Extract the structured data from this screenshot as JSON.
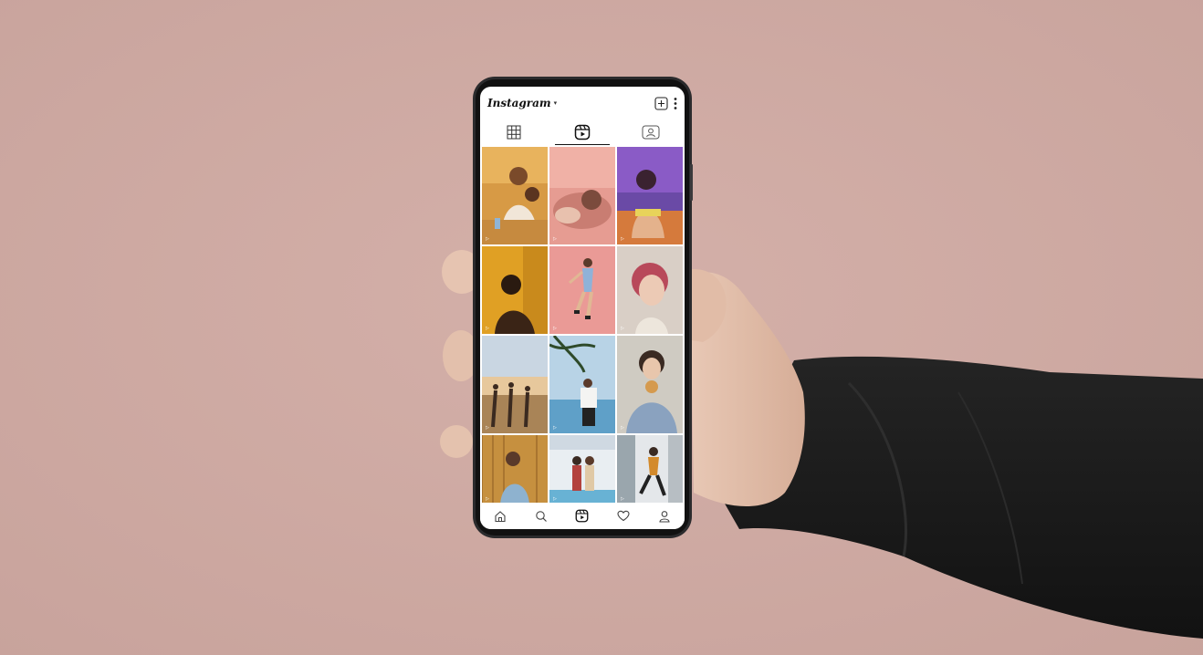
{
  "app": {
    "title": "Instagram",
    "account_dropdown_icon": "chevron-down-icon",
    "header_icons": [
      "add-post-icon",
      "more-options-icon"
    ]
  },
  "profile_tabs": [
    {
      "name": "posts-grid",
      "icon": "grid-icon",
      "active": false
    },
    {
      "name": "reels",
      "icon": "reels-icon",
      "active": true
    },
    {
      "name": "tagged",
      "icon": "tagged-user-icon",
      "active": false
    }
  ],
  "reels_grid": {
    "columns": 3,
    "tiles": [
      {
        "subject": "two women at a cafe table",
        "play_icon": "play-icon"
      },
      {
        "subject": "woman lying down, pink light",
        "play_icon": "play-icon"
      },
      {
        "subject": "woman in neon purple light",
        "play_icon": "play-icon"
      },
      {
        "subject": "woman in golden light",
        "play_icon": "play-icon"
      },
      {
        "subject": "person jumping, pink background",
        "play_icon": "play-icon"
      },
      {
        "subject": "portrait with red hair",
        "play_icon": "play-icon"
      },
      {
        "subject": "friends on beach at sunset",
        "play_icon": "play-icon"
      },
      {
        "subject": "man under palm tree",
        "play_icon": "play-icon"
      },
      {
        "subject": "woman eating food",
        "play_icon": "play-icon"
      },
      {
        "subject": "man against wooden wall",
        "play_icon": "play-icon"
      },
      {
        "subject": "two women by a pool",
        "play_icon": "play-icon"
      },
      {
        "subject": "man dancing in street",
        "play_icon": "play-icon"
      }
    ]
  },
  "bottom_nav": [
    {
      "name": "home",
      "icon": "home-icon"
    },
    {
      "name": "search",
      "icon": "search-icon"
    },
    {
      "name": "reels",
      "icon": "reels-icon",
      "active": true
    },
    {
      "name": "activity",
      "icon": "heart-icon"
    },
    {
      "name": "profile",
      "icon": "profile-icon"
    }
  ],
  "colors": {
    "backdrop": "#cfaaa3",
    "phone_frame": "#2b2b2d",
    "sleeve": "#1b1b1b",
    "skin": "#e2c0ac",
    "screen": "#ffffff"
  }
}
